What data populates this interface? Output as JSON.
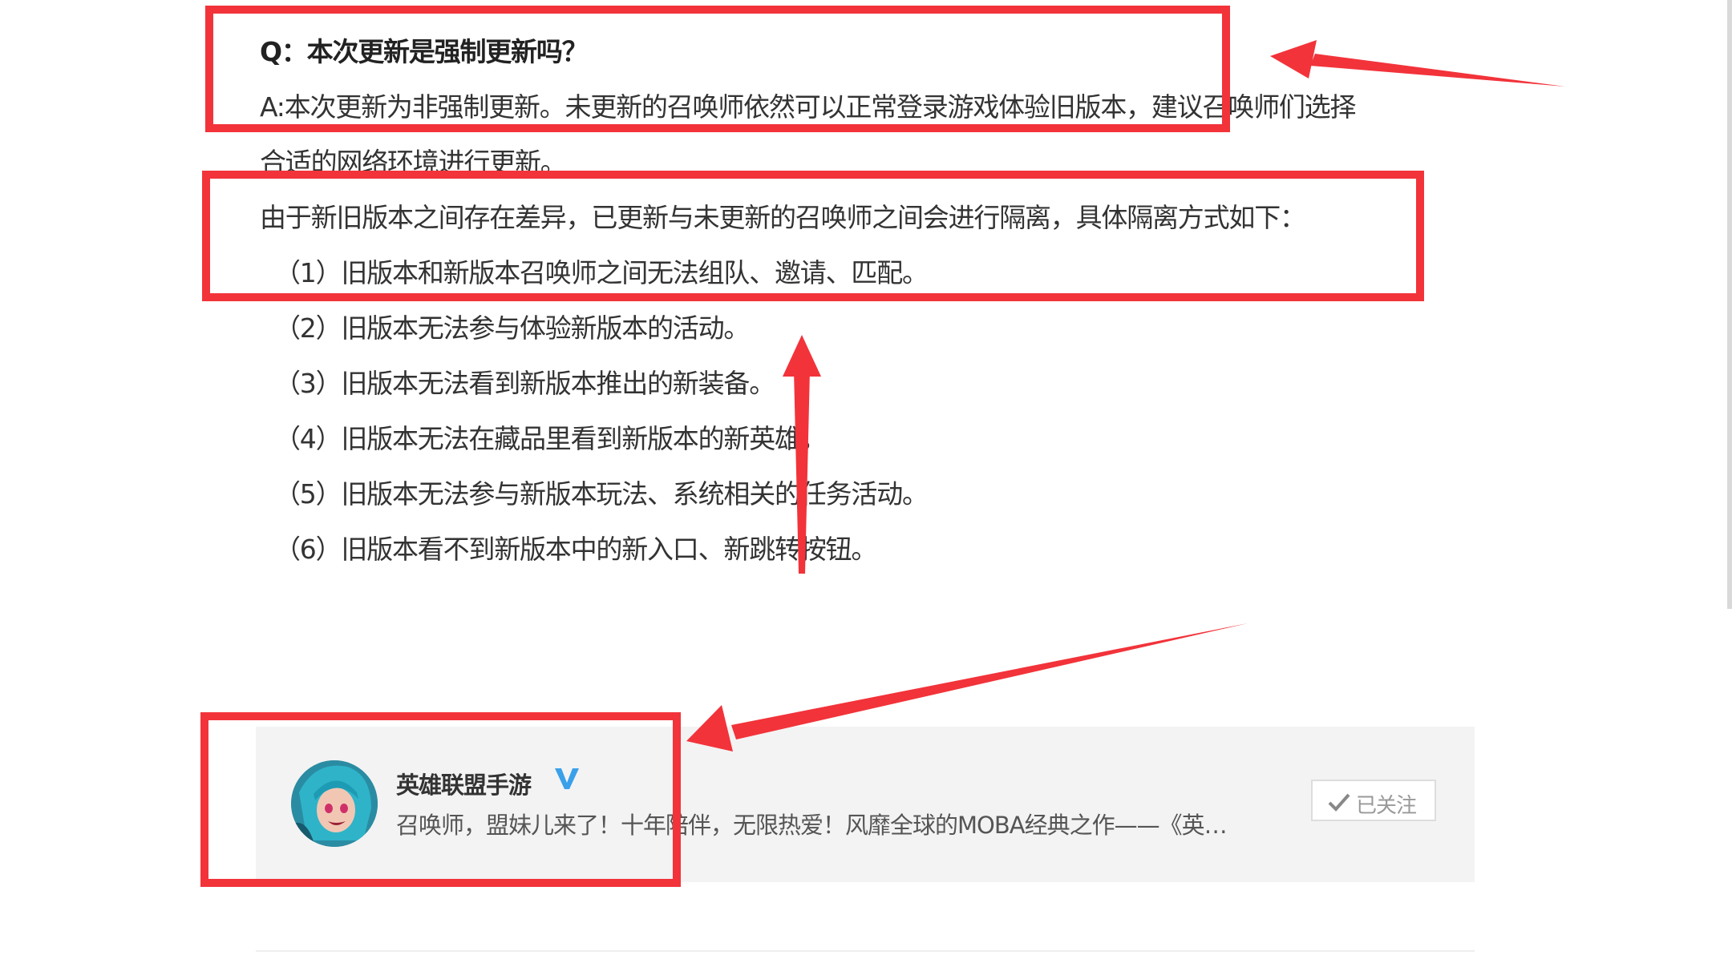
{
  "article": {
    "question": "Q：本次更新是强制更新吗？",
    "answer_line1": "A:本次更新为非强制更新。未更新的召唤师依然可以正常登录游戏体验旧版本，建议召唤师们选择",
    "answer_line2": "合适的网络环境进行更新。",
    "intro": "由于新旧版本之间存在差异，已更新与未更新的召唤师之间会进行隔离，具体隔离方式如下：",
    "items": [
      "（1）旧版本和新版本召唤师之间无法组队、邀请、匹配。",
      "（2）旧版本无法参与体验新版本的活动。",
      "（3）旧版本无法看到新版本推出的新装备。",
      "（4）旧版本无法在藏品里看到新版本的新英雄。",
      "（5）旧版本无法参与新版本玩法、系统相关的任务活动。",
      "（6）旧版本看不到新版本中的新入口、新跳转按钮。"
    ]
  },
  "account_card": {
    "name": "英雄联盟手游",
    "verified_icon": "verified-v-icon",
    "description": "召唤师，盟妹儿来了！十年陪伴，无限热爱！风靡全球的MOBA经典之作——《英…",
    "follow_label": "已关注",
    "follow_icon": "check-icon"
  },
  "colors": {
    "annotation_red": "#f2333a",
    "verified_blue": "#3aa0ea",
    "card_background": "#f3f3f3",
    "text": "#333333"
  }
}
